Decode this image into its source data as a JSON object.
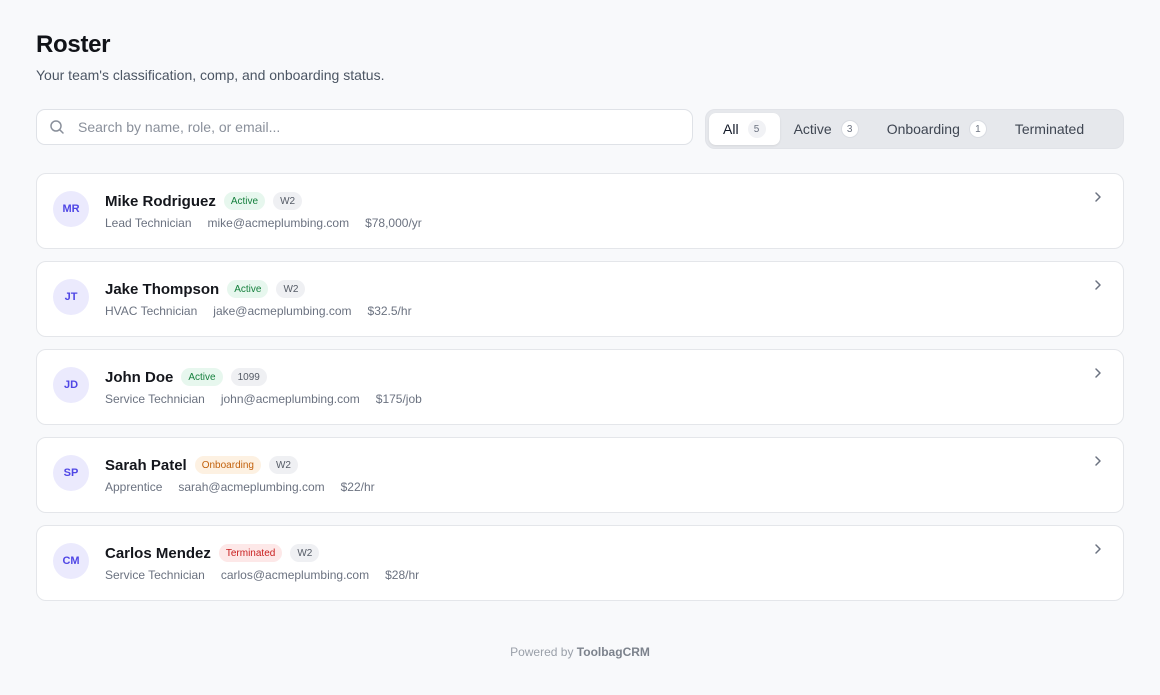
{
  "header": {
    "title": "Roster",
    "subtitle": "Your team's classification, comp, and onboarding status."
  },
  "search": {
    "placeholder": "Search by name, role, or email...",
    "icon": "search-icon"
  },
  "tabs": [
    {
      "label": "All",
      "count": "5",
      "active": true
    },
    {
      "label": "Active",
      "count": "3",
      "active": false
    },
    {
      "label": "Onboarding",
      "count": "1",
      "active": false
    },
    {
      "label": "Terminated",
      "count": "",
      "active": false
    }
  ],
  "employees": [
    {
      "initials": "MR",
      "name": "Mike Rodriguez",
      "status": "Active",
      "type": "W2",
      "role": "Lead Technician",
      "email": "mike@acmeplumbing.com",
      "comp": "$78,000/yr"
    },
    {
      "initials": "JT",
      "name": "Jake Thompson",
      "status": "Active",
      "type": "W2",
      "role": "HVAC Technician",
      "email": "jake@acmeplumbing.com",
      "comp": "$32.5/hr"
    },
    {
      "initials": "JD",
      "name": "John Doe",
      "status": "Active",
      "type": "1099",
      "role": "Service Technician",
      "email": "john@acmeplumbing.com",
      "comp": "$175/job"
    },
    {
      "initials": "SP",
      "name": "Sarah Patel",
      "status": "Onboarding",
      "type": "W2",
      "role": "Apprentice",
      "email": "sarah@acmeplumbing.com",
      "comp": "$22/hr"
    },
    {
      "initials": "CM",
      "name": "Carlos Mendez",
      "status": "Terminated",
      "type": "W2",
      "role": "Service Technician",
      "email": "carlos@acmeplumbing.com",
      "comp": "$28/hr"
    }
  ],
  "footer": {
    "prefix": "Powered by",
    "brand": "ToolbagCRM"
  },
  "colors": {
    "accent": "#4f46e5",
    "active": "#15803d",
    "onboarding": "#c2610c",
    "terminated": "#c81e1e"
  }
}
